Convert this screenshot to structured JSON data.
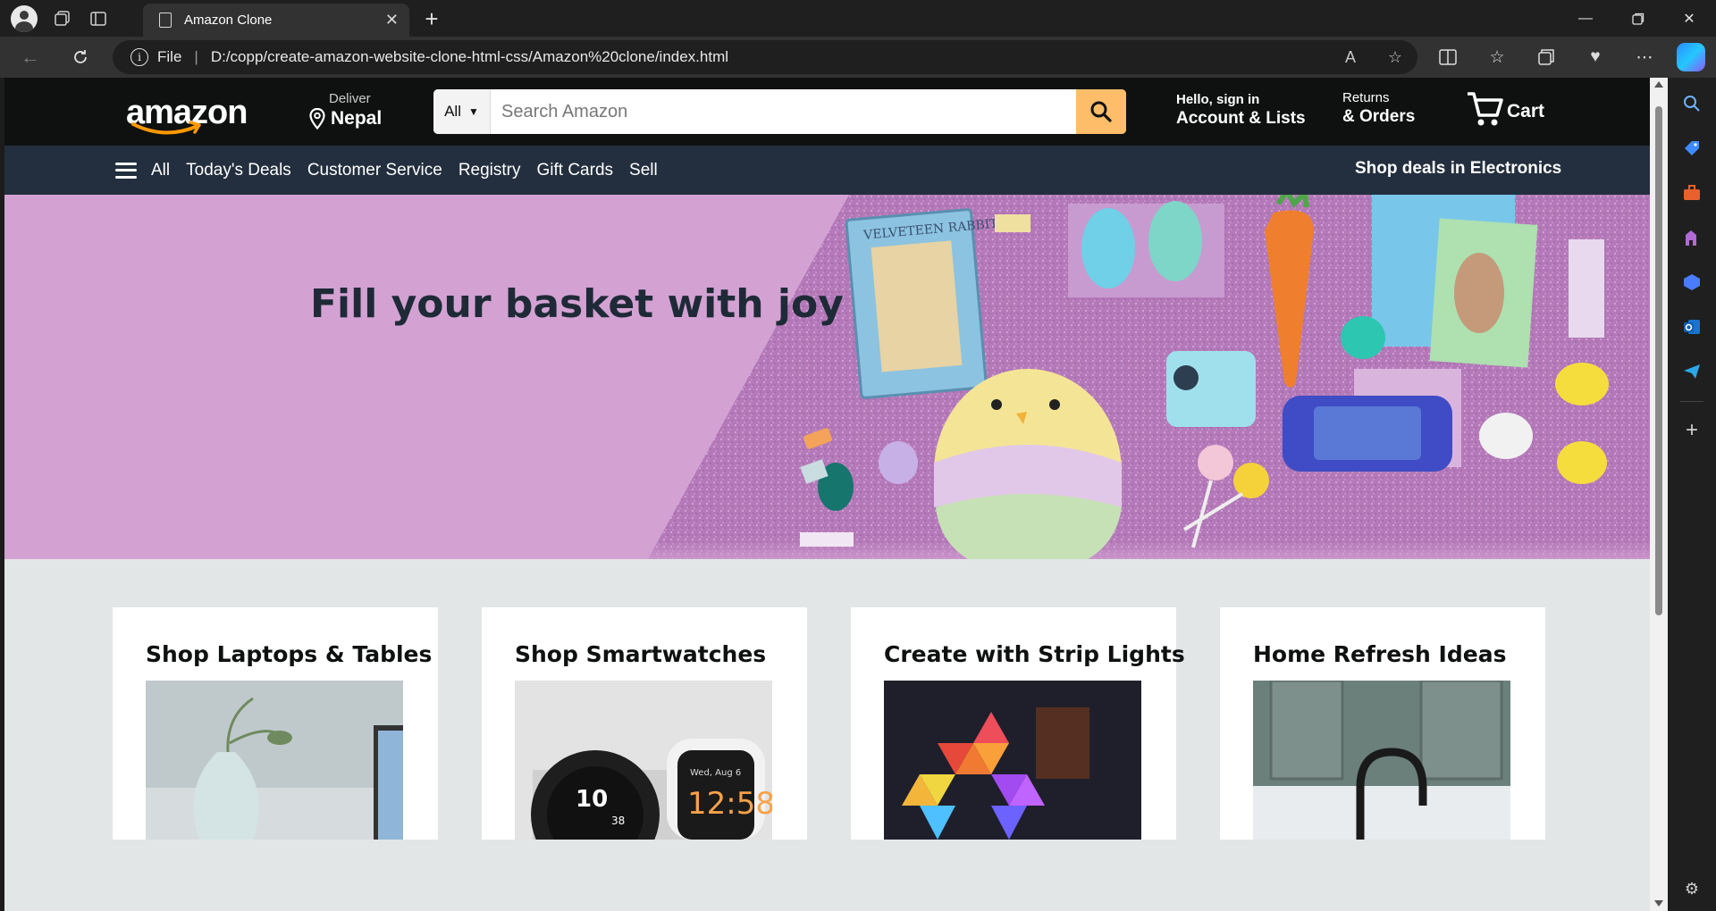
{
  "browser": {
    "tab_title": "Amazon Clone",
    "url_scheme": "File",
    "url": "D:/copp/create-amazon-website-clone-html-css/Amazon%20clone/index.html"
  },
  "header": {
    "logo_text": "amazon",
    "deliver_label": "Deliver",
    "deliver_location": "Nepal",
    "search_category": "All",
    "search_placeholder": "Search Amazon",
    "signin_line1": "Hello, sign in",
    "signin_line2": "Account & Lists",
    "returns_line1": "Returns",
    "returns_line2": "& Orders",
    "cart_label": "Cart"
  },
  "subnav": {
    "all_label": "All",
    "items": [
      "Today's Deals",
      "Customer Service",
      "Registry",
      "Gift Cards",
      "Sell"
    ],
    "promo": "Shop deals in Electronics"
  },
  "hero": {
    "headline": "Fill your basket with joy"
  },
  "cards": [
    {
      "title": "Shop Laptops & Tables"
    },
    {
      "title": "Shop Smartwatches"
    },
    {
      "title": "Create with Strip Lights"
    },
    {
      "title": "Home Refresh Ideas"
    }
  ],
  "smartwatch_display": {
    "left_time": "10",
    "left_seconds": "38",
    "right_date": "Wed, Aug 6",
    "right_time": "12:58"
  },
  "colors": {
    "header_bg": "#0f1111",
    "subnav_bg": "#232f3e",
    "search_button": "#febd69",
    "hero_bg": "#d3a2d3",
    "page_bg": "#e3e6e6"
  }
}
